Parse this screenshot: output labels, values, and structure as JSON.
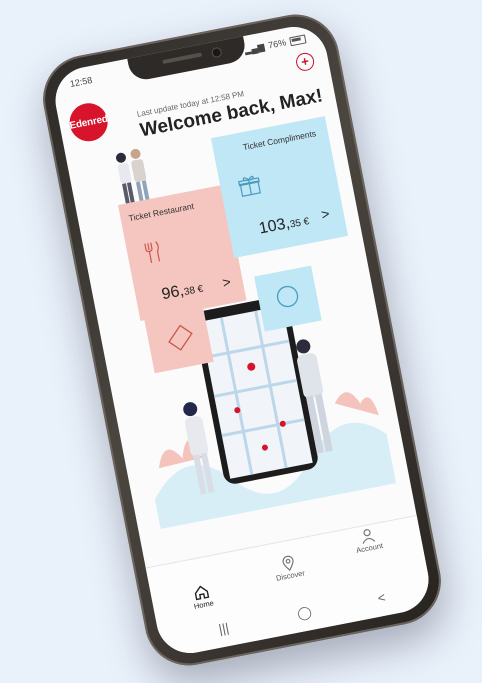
{
  "status": {
    "time": "12:58",
    "battery": "76%"
  },
  "header": {
    "logo_text": "Edenred",
    "last_update": "Last update today at 12:58 PM",
    "welcome": "Welcome back, Max!"
  },
  "cards": [
    {
      "title": "Ticket Restaurant",
      "amount_main": "96,",
      "amount_cents": "38 €",
      "icon": "cutlery-icon",
      "color": "#f5c6bf"
    },
    {
      "title": "Ticket Compliments",
      "amount_main": "103,",
      "amount_cents": "35 €",
      "icon": "gift-icon",
      "color": "#bfe7f5"
    }
  ],
  "nav": {
    "home": "Home",
    "discover": "Discover",
    "account": "Account"
  },
  "colors": {
    "brand": "#d7142b",
    "background": "#e9f1fb",
    "accent_blue": "#bfe7f5",
    "accent_pink": "#f5c6bf"
  }
}
